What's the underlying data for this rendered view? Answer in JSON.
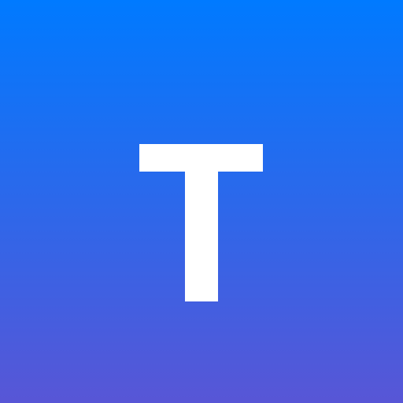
{
  "tile": {
    "letter": "T",
    "gradient_top": "#007aff",
    "gradient_bottom": "#5856d6",
    "letter_color": "#ffffff"
  }
}
